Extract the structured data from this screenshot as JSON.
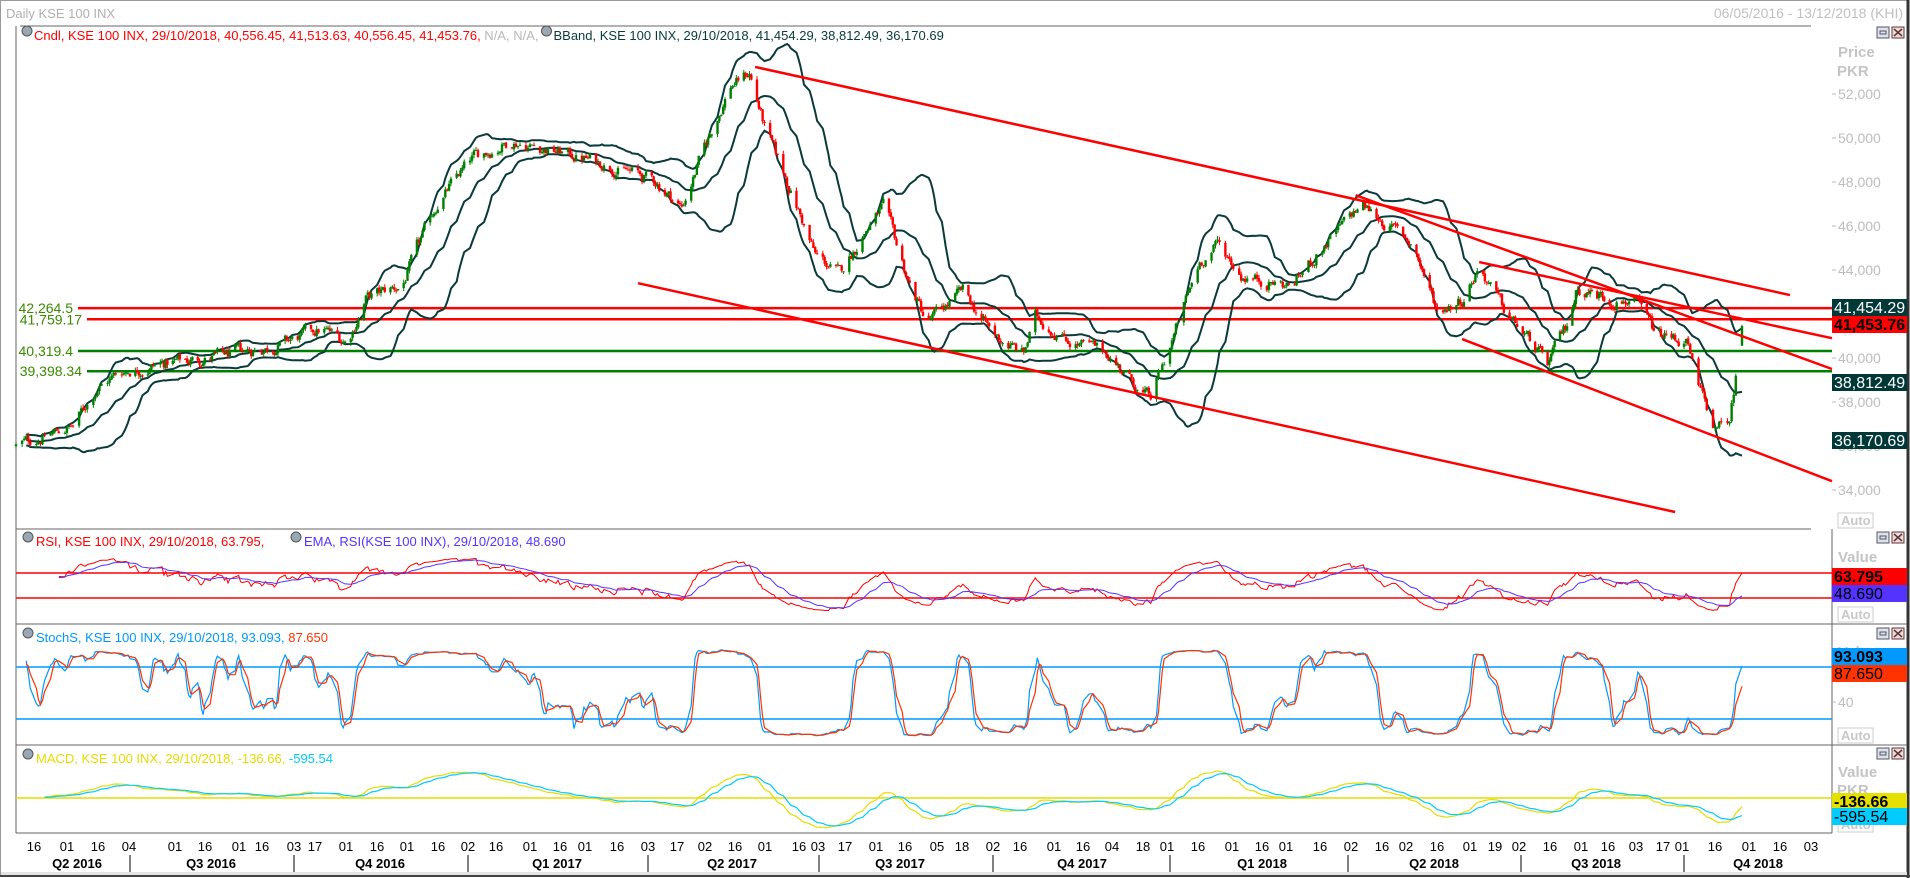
{
  "header": {
    "title": "Daily KSE 100 INX",
    "date_range": "06/05/2016 - 13/12/2018 (KHI)"
  },
  "panes": {
    "price": {
      "legend_cndl": "Cndl, KSE 100 INX, 29/10/2018, 40,556.45, 41,513.63, 40,556.45, 41,453.76,",
      "legend_na": " N/A, N/A,",
      "legend_bband": "BBand, KSE 100 INX, 29/10/2018, 41,454.29, 38,812.49, 36,170.69",
      "axis_title_1": "Price",
      "axis_title_2": "PKR",
      "auto": "Auto",
      "yticks": [
        "52,000",
        "50,000",
        "48,000",
        "46,000",
        "44,000",
        "42,000",
        "40,000",
        "38,000",
        "36,000",
        "34,000"
      ],
      "boxes": [
        {
          "label": "41,454.29",
          "bg": "#003838",
          "fg": "#ffffff",
          "bold": false
        },
        {
          "label": "41,453.76",
          "bg": "#ff0000",
          "fg": "#000000",
          "bold": true
        },
        {
          "label": "38,812.49",
          "bg": "#003838",
          "fg": "#ffffff",
          "bold": false
        },
        {
          "label": "36,170.69",
          "bg": "#003838",
          "fg": "#ffffff",
          "bold": false
        }
      ]
    },
    "rsi": {
      "legend_rsi": "RSI, KSE 100 INX, 29/10/2018, 63.795,",
      "legend_ema": "EMA, RSI(KSE 100 INX), 29/10/2018, 48.690",
      "axis_title": "Value",
      "auto": "Auto",
      "boxes": [
        {
          "label": "63.795",
          "bg": "#ff0000",
          "fg": "#000000",
          "bold": true
        },
        {
          "label": "48.690",
          "bg": "#5533ff",
          "fg": "#000000",
          "bold": false
        }
      ]
    },
    "stoch": {
      "legend_k": "StochS, KSE 100 INX, 29/10/2018, 93.093,",
      "legend_d": " 87.650",
      "axis_title": "Value",
      "ytick": "40",
      "auto": "Auto",
      "boxes": [
        {
          "label": "93.093",
          "bg": "#0099ff",
          "fg": "#000000",
          "bold": true
        },
        {
          "label": "87.650",
          "bg": "#ff3300",
          "fg": "#000000",
          "bold": false
        }
      ]
    },
    "macd": {
      "legend_macd": "MACD, KSE 100 INX, 29/10/2018, -136.66,",
      "legend_signal": " -595.54",
      "axis_title_1": "Value",
      "axis_title_2": "PKR",
      "auto": "Auto",
      "boxes": [
        {
          "label": "-136.66",
          "bg": "#e6e000",
          "fg": "#000000",
          "bold": true
        },
        {
          "label": "-595.54",
          "bg": "#00ccff",
          "fg": "#000000",
          "bold": false
        }
      ]
    }
  },
  "x_axis": {
    "ticks": [
      "16",
      "01",
      "16",
      "04",
      "01",
      "16",
      "01",
      "16",
      "03",
      "17",
      "01",
      "16",
      "01",
      "16",
      "02",
      "16",
      "01",
      "16",
      "01",
      "16",
      "03",
      "17",
      "02",
      "16",
      "01",
      "16",
      "03",
      "17",
      "01",
      "16",
      "05",
      "18",
      "02",
      "16",
      "01",
      "16",
      "04",
      "18",
      "01",
      "16",
      "01",
      "16",
      "01",
      "16",
      "02",
      "16",
      "02",
      "16",
      "01",
      "19",
      "02",
      "16",
      "01",
      "16",
      "03",
      "17",
      "01",
      "16",
      "01",
      "16",
      "03"
    ],
    "quarters": [
      "Q2 2016",
      "Q3 2016",
      "Q4 2016",
      "Q1 2017",
      "Q2 2017",
      "Q3 2017",
      "Q4 2017",
      "Q1 2018",
      "Q2 2018",
      "Q3 2018",
      "Q4 2018"
    ]
  },
  "colors": {
    "up": "#008000",
    "down": "#ff0000",
    "bband": "#0a3a3a",
    "rsi": "#ff0000",
    "rsi_ema": "#5533ff",
    "stoch_k": "#0099ff",
    "stoch_d": "#ff3300",
    "macd": "#e6dc00",
    "macd_signal": "#00ccff",
    "trendline": "#ff0000",
    "support": "#008000"
  },
  "chart_data": [
    {
      "type": "candlestick",
      "title": "Daily KSE 100 INX",
      "ylabel": "Price PKR",
      "ylim": [
        33000,
        54000
      ],
      "x_range": [
        "2016-05-06",
        "2018-12-13"
      ],
      "last_bar": {
        "date": "29/10/2018",
        "open": 40556.45,
        "high": 41513.63,
        "low": 40556.45,
        "close": 41453.76
      },
      "bollinger_last": {
        "upper": 41454.29,
        "middle": 38812.49,
        "lower": 36170.69
      },
      "close_keypoints": [
        {
          "date": "2016-05-06",
          "close": 36000
        },
        {
          "date": "2016-06-03",
          "close": 36900
        },
        {
          "date": "2016-06-15",
          "close": 38680
        },
        {
          "date": "2016-06-27",
          "close": 39400
        },
        {
          "date": "2016-07-24",
          "close": 39800
        },
        {
          "date": "2016-08-20",
          "close": 40050
        },
        {
          "date": "2016-09-23",
          "close": 40600
        },
        {
          "date": "2016-10-16",
          "close": 41300
        },
        {
          "date": "2016-10-29",
          "close": 40700
        },
        {
          "date": "2016-11-08",
          "close": 42700
        },
        {
          "date": "2016-11-27",
          "close": 43270
        },
        {
          "date": "2016-12-16",
          "close": 47100
        },
        {
          "date": "2017-01-04",
          "close": 49100
        },
        {
          "date": "2017-01-23",
          "close": 49900
        },
        {
          "date": "2017-02-16",
          "close": 49350
        },
        {
          "date": "2017-03-12",
          "close": 48800
        },
        {
          "date": "2017-04-06",
          "close": 47950
        },
        {
          "date": "2017-04-19",
          "close": 46850
        },
        {
          "date": "2017-04-29",
          "close": 49100
        },
        {
          "date": "2017-05-15",
          "close": 52400
        },
        {
          "date": "2017-05-25",
          "close": 52950
        },
        {
          "date": "2017-06-03",
          "close": 50200
        },
        {
          "date": "2017-06-17",
          "close": 47400
        },
        {
          "date": "2017-06-29",
          "close": 44650
        },
        {
          "date": "2017-07-12",
          "close": 43800
        },
        {
          "date": "2017-07-25",
          "close": 45750
        },
        {
          "date": "2017-08-04",
          "close": 46850
        },
        {
          "date": "2017-08-17",
          "close": 43550
        },
        {
          "date": "2017-08-27",
          "close": 41600
        },
        {
          "date": "2017-09-15",
          "close": 43000
        },
        {
          "date": "2017-10-01",
          "close": 41050
        },
        {
          "date": "2017-10-17",
          "close": 40200
        },
        {
          "date": "2017-10-23",
          "close": 41850
        },
        {
          "date": "2017-11-11",
          "close": 40750
        },
        {
          "date": "2017-11-30",
          "close": 40200
        },
        {
          "date": "2017-12-16",
          "close": 38550
        },
        {
          "date": "2017-12-22",
          "close": 38100
        },
        {
          "date": "2018-01-03",
          "close": 41050
        },
        {
          "date": "2018-01-16",
          "close": 44350
        },
        {
          "date": "2018-01-25",
          "close": 45200
        },
        {
          "date": "2018-02-06",
          "close": 43800
        },
        {
          "date": "2018-03-03",
          "close": 43250
        },
        {
          "date": "2018-03-21",
          "close": 45200
        },
        {
          "date": "2018-04-08",
          "close": 46950
        },
        {
          "date": "2018-04-23",
          "close": 46000
        },
        {
          "date": "2018-05-05",
          "close": 45200
        },
        {
          "date": "2018-05-18",
          "close": 42150
        },
        {
          "date": "2018-05-31",
          "close": 42700
        },
        {
          "date": "2018-06-09",
          "close": 44200
        },
        {
          "date": "2018-06-22",
          "close": 42150
        },
        {
          "date": "2018-07-06",
          "close": 40750
        },
        {
          "date": "2018-07-16",
          "close": 39700
        },
        {
          "date": "2018-07-26",
          "close": 41300
        },
        {
          "date": "2018-08-02",
          "close": 43250
        },
        {
          "date": "2018-08-19",
          "close": 42700
        },
        {
          "date": "2018-09-02",
          "close": 42700
        },
        {
          "date": "2018-09-15",
          "close": 41050
        },
        {
          "date": "2018-10-02",
          "close": 40750
        },
        {
          "date": "2018-10-08",
          "close": 38550
        },
        {
          "date": "2018-10-17",
          "close": 36650
        },
        {
          "date": "2018-10-23",
          "close": 37200
        },
        {
          "date": "2018-10-26",
          "close": 39100
        },
        {
          "date": "2018-10-29",
          "close": 41453.76
        }
      ],
      "horizontal_lines": [
        {
          "value": 42264.5,
          "label": "42,264.5",
          "color": "#ff0000"
        },
        {
          "value": 41759.17,
          "label": "41,759.17",
          "color": "#ff0000"
        },
        {
          "value": 40319.4,
          "label": "40,319.4",
          "color": "#008000"
        },
        {
          "value": 39398.34,
          "label": "39,398.34",
          "color": "#008000"
        }
      ],
      "trendlines": [
        {
          "from": {
            "date": "2017-05-28",
            "price": 53230
          },
          "to": {
            "date": "2018-11-22",
            "price": 42860
          }
        },
        {
          "from": {
            "date": "2017-03-27",
            "price": 43400
          },
          "to": {
            "date": "2018-09-26",
            "price": 33000
          }
        },
        {
          "from": {
            "date": "2018-04-05",
            "price": 47400
          },
          "to": {
            "date": "2018-12-13",
            "price": 39500
          }
        },
        {
          "from": {
            "date": "2018-06-09",
            "price": 44360
          },
          "to": {
            "date": "2018-12-13",
            "price": 40900
          }
        },
        {
          "from": {
            "date": "2018-05-31",
            "price": 40860
          },
          "to": {
            "date": "2018-12-13",
            "price": 34400
          }
        }
      ]
    },
    {
      "type": "line",
      "title": "RSI",
      "series": [
        {
          "name": "RSI",
          "last": 63.795
        },
        {
          "name": "EMA, RSI",
          "last": 48.69
        }
      ],
      "levels": [
        70,
        30
      ]
    },
    {
      "type": "line",
      "title": "StochS",
      "series": [
        {
          "name": "%K",
          "last": 93.093
        },
        {
          "name": "%D",
          "last": 87.65
        }
      ],
      "levels": [
        80,
        20
      ],
      "yticks": [
        40
      ]
    },
    {
      "type": "line",
      "title": "MACD",
      "series": [
        {
          "name": "MACD",
          "last": -136.66
        },
        {
          "name": "Signal",
          "last": -595.54
        }
      ],
      "levels": [
        0
      ]
    }
  ]
}
